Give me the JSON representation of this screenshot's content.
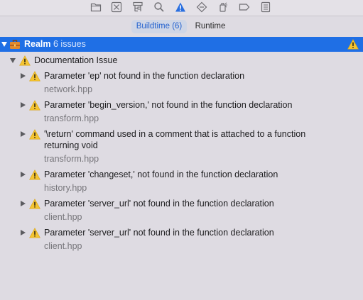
{
  "toolbar": {
    "icons": [
      "folder-icon",
      "source-control-icon",
      "hierarchy-icon",
      "search-icon",
      "issue-warning-icon",
      "test-diamond-icon",
      "debug-spray-icon",
      "breakpoint-tag-icon",
      "report-list-icon"
    ],
    "active_icon": "issue-warning-icon",
    "accent_color": "#1f6fe5"
  },
  "tabs": {
    "buildtime": "Buildtime (6)",
    "runtime": "Runtime"
  },
  "realm": {
    "name": "Realm",
    "count": "6 issues",
    "icon": "toolbox-icon"
  },
  "group": {
    "title": "Documentation Issue"
  },
  "issues": [
    {
      "message": "Parameter 'ep' not found in the function declaration",
      "file": "network.hpp"
    },
    {
      "message": "Parameter 'begin_version,' not found in the function declaration",
      "file": "transform.hpp"
    },
    {
      "message": "'\\return' command used in a comment that is attached to a function returning void",
      "file": "transform.hpp"
    },
    {
      "message": "Parameter 'changeset,' not found in the function declaration",
      "file": "history.hpp"
    },
    {
      "message": "Parameter 'server_url' not found in the function declaration",
      "file": "client.hpp"
    },
    {
      "message": "Parameter 'server_url' not found in the function declaration",
      "file": "client.hpp"
    }
  ]
}
